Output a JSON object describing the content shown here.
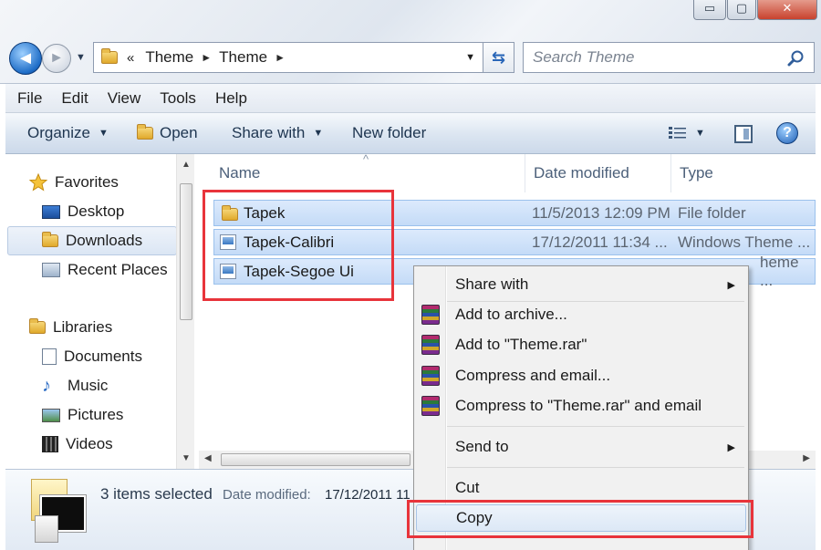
{
  "window": {
    "caption_min": "▭",
    "caption_max": "▢",
    "caption_close": "✕"
  },
  "nav": {
    "back": "◄",
    "forward": "►",
    "recent_dropdown": "▼",
    "crumb_prefix": "«",
    "crumbs": [
      "Theme",
      "Theme"
    ],
    "crumb_sep": "►",
    "address_dropdown": "▼",
    "refresh": "⇆"
  },
  "search": {
    "placeholder": "Search Theme",
    "icon": "search-icon"
  },
  "menubar": [
    "File",
    "Edit",
    "View",
    "Tools",
    "Help"
  ],
  "commandbar": {
    "organize": "Organize",
    "open": "Open",
    "share_with": "Share with",
    "new_folder": "New folder",
    "caret": "▼"
  },
  "navpane": {
    "favorites": "Favorites",
    "desktop": "Desktop",
    "downloads": "Downloads",
    "recent_places": "Recent Places",
    "libraries": "Libraries",
    "documents": "Documents",
    "music": "Music",
    "pictures": "Pictures",
    "videos": "Videos"
  },
  "columns": {
    "name": "Name",
    "date": "Date modified",
    "type": "Type",
    "sort_arrow": "^"
  },
  "files": [
    {
      "name": "Tapek",
      "date": "11/5/2013 12:09 PM",
      "type": "File folder"
    },
    {
      "name": "Tapek-Calibri",
      "date": "17/12/2011 11:34 ...",
      "type": "Windows Theme ..."
    },
    {
      "name": "Tapek-Segoe Ui",
      "date": "",
      "type": "heme ..."
    }
  ],
  "details": {
    "selected": "3 items selected",
    "date_label": "Date modified:",
    "date_value": "17/12/2011 11"
  },
  "context_menu": {
    "share_with": "Share with",
    "add_archive": "Add to archive...",
    "add_rar": "Add to \"Theme.rar\"",
    "compress_email": "Compress and email...",
    "compress_rar_email": "Compress to \"Theme.rar\" and email",
    "send_to": "Send to",
    "cut": "Cut",
    "copy": "Copy",
    "submenu_arrow": "▶"
  },
  "colors": {
    "highlight": "#e8343b",
    "selection": "#c4dbf7"
  }
}
